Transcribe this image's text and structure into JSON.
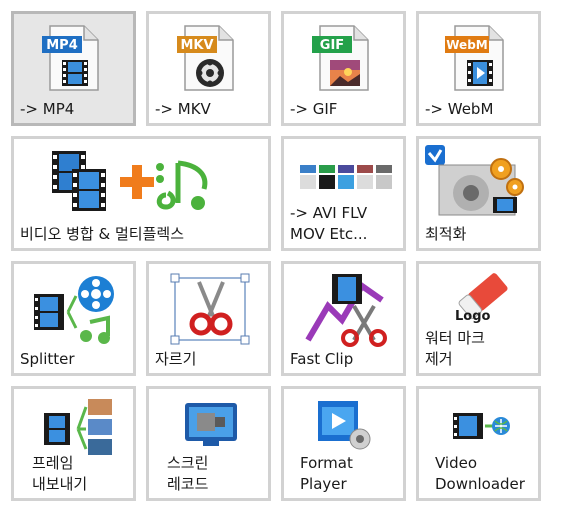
{
  "tiles": [
    {
      "label": "-> MP4",
      "badge": "MP4",
      "icon": "mp4-file-icon",
      "color": "#1f6fc3"
    },
    {
      "label": "-> MKV",
      "badge": "MKV",
      "icon": "mkv-file-icon",
      "color": "#d68a1c"
    },
    {
      "label": "-> GIF",
      "badge": "GIF",
      "icon": "gif-file-icon",
      "color": "#23a14a"
    },
    {
      "label": "-> WebM",
      "badge": "WebM",
      "icon": "webm-file-icon",
      "color": "#e07b12"
    },
    {
      "label": "비디오 병합 & 멀티플렉스",
      "icon": "merge-multiplex-icon"
    },
    {
      "label": "-> AVI FLV\nMOV Etc...",
      "icon": "other-formats-icon"
    },
    {
      "label": "최적화",
      "icon": "optimize-gears-icon"
    },
    {
      "label": "Splitter",
      "icon": "splitter-icon"
    },
    {
      "label": "자르기",
      "icon": "crop-scissors-icon"
    },
    {
      "label": "Fast Clip",
      "icon": "fast-clip-icon"
    },
    {
      "label": "워터 마크\n제거",
      "icon": "eraser-icon",
      "sublabel": "Logo"
    },
    {
      "label": "프레임\n내보내기",
      "icon": "frame-export-icon"
    },
    {
      "label": "스크린\n레코드",
      "icon": "screen-record-icon"
    },
    {
      "label": "Format\nPlayer",
      "icon": "player-icon"
    },
    {
      "label": "Video\nDownloader",
      "icon": "video-downloader-icon"
    }
  ]
}
